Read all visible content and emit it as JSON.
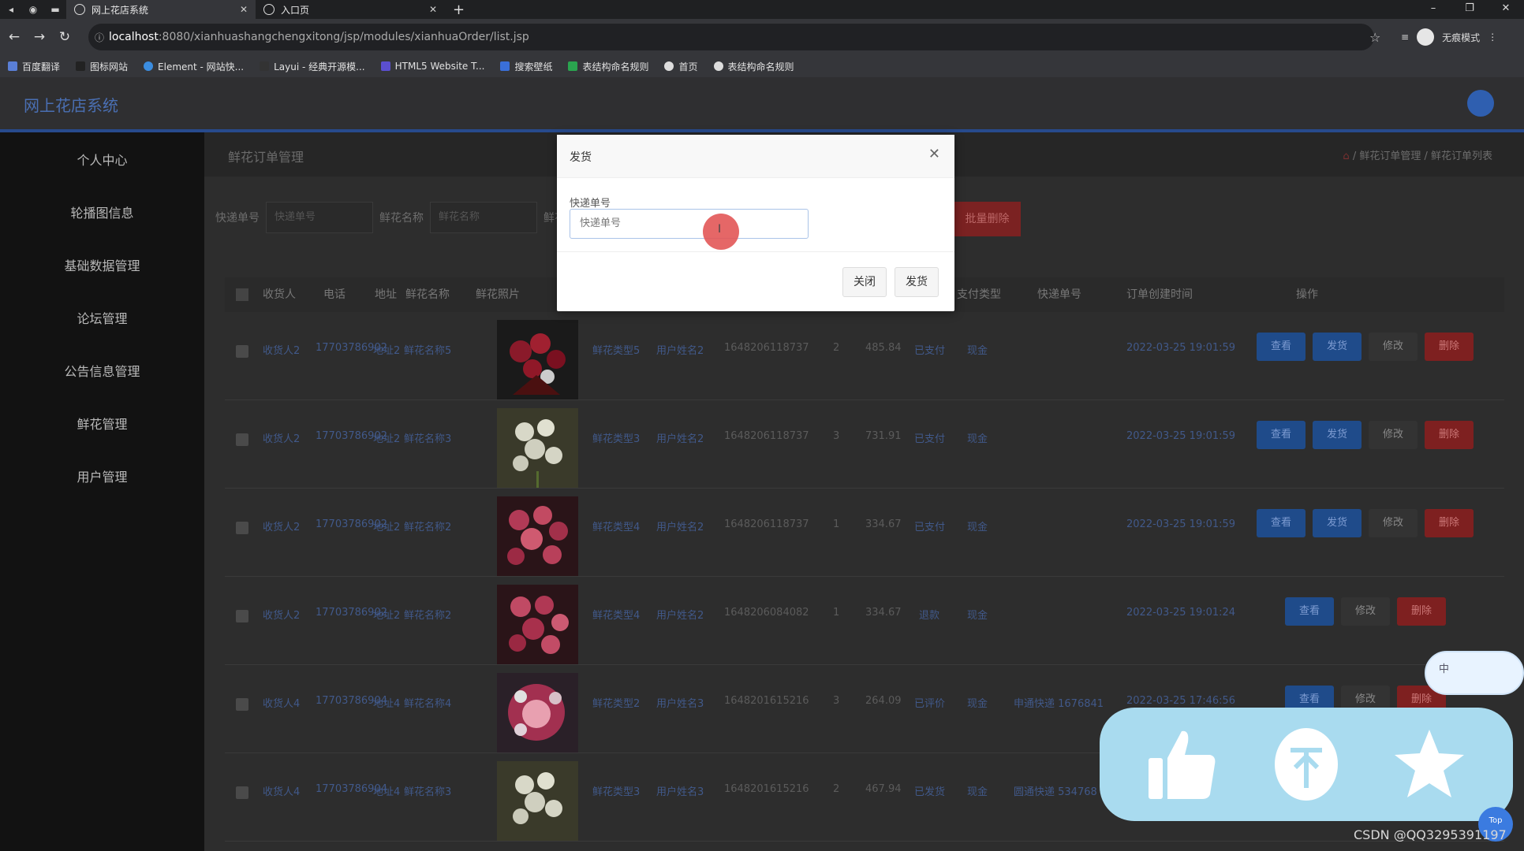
{
  "browser": {
    "tabs": [
      {
        "title": "网上花店系统",
        "active": true
      },
      {
        "title": "入口页",
        "active": false
      }
    ],
    "url_host": "localhost",
    "url_path": ":8080/xianhuashangchengxitong/jsp/modules/xianhuaOrder/list.jsp",
    "incognito_label": "无痕模式",
    "bookmarks": [
      "百度翻译",
      "图标网站",
      "Element - 网站快...",
      "Layui - 经典开源模...",
      "HTML5 Website T...",
      "搜索壁纸",
      "表结构命名规则",
      "首页",
      "表结构命名规则"
    ]
  },
  "app": {
    "title": "网上花店系统",
    "sidebar": [
      "个人中心",
      "轮播图信息",
      "基础数据管理",
      "论坛管理",
      "公告信息管理",
      "鲜花管理",
      "用户管理"
    ]
  },
  "main": {
    "crumb_title": "鲜花订单管理",
    "breadcrumb": "鲜花订单管理 / 鲜花订单列表",
    "search": {
      "label1": "快递单号",
      "placeholder1": "快递单号",
      "label2": "鲜花名称",
      "placeholder2": "鲜花名称",
      "label3": "鲜花"
    },
    "batch_delete": "批量删除",
    "headers": [
      "收货人",
      "电话",
      "地址",
      "鲜花名称",
      "鲜花照片",
      "支付类型",
      "快递单号",
      "订单创建时间",
      "操作"
    ],
    "rows": [
      {
        "receiver": "收货人2",
        "phone": "17703786902",
        "addr": "地址2",
        "flower": "鲜花名称5",
        "type": "鲜花类型5",
        "user": "用户姓名2",
        "order_no": "1648206118737",
        "qty": "2",
        "price": "485.84",
        "status": "已支付",
        "pay": "现金",
        "express": "",
        "time": "2022-03-25 19:01:59",
        "actions": [
          "查看",
          "发货",
          "修改",
          "删除"
        ],
        "photo": "red"
      },
      {
        "receiver": "收货人2",
        "phone": "17703786902",
        "addr": "地址2",
        "flower": "鲜花名称3",
        "type": "鲜花类型3",
        "user": "用户姓名2",
        "order_no": "1648206118737",
        "qty": "3",
        "price": "731.91",
        "status": "已支付",
        "pay": "现金",
        "express": "",
        "time": "2022-03-25 19:01:59",
        "actions": [
          "查看",
          "发货",
          "修改",
          "删除"
        ],
        "photo": "white"
      },
      {
        "receiver": "收货人2",
        "phone": "17703786902",
        "addr": "地址2",
        "flower": "鲜花名称2",
        "type": "鲜花类型4",
        "user": "用户姓名2",
        "order_no": "1648206118737",
        "qty": "1",
        "price": "334.67",
        "status": "已支付",
        "pay": "现金",
        "express": "",
        "time": "2022-03-25 19:01:59",
        "actions": [
          "查看",
          "发货",
          "修改",
          "删除"
        ],
        "photo": "pink"
      },
      {
        "receiver": "收货人2",
        "phone": "17703786902",
        "addr": "地址2",
        "flower": "鲜花名称2",
        "type": "鲜花类型4",
        "user": "用户姓名2",
        "order_no": "1648206084082",
        "qty": "1",
        "price": "334.67",
        "status": "退款",
        "pay": "现金",
        "express": "",
        "time": "2022-03-25 19:01:24",
        "actions": [
          "查看",
          "修改",
          "删除"
        ],
        "photo": "pink"
      },
      {
        "receiver": "收货人4",
        "phone": "17703786904",
        "addr": "地址4",
        "flower": "鲜花名称4",
        "type": "鲜花类型2",
        "user": "用户姓名3",
        "order_no": "1648201615216",
        "qty": "3",
        "price": "264.09",
        "status": "已评价",
        "pay": "现金",
        "express": "申通快递 1676841",
        "time": "2022-03-25 17:46:56",
        "actions": [
          "查看",
          "修改",
          "删除"
        ],
        "photo": "mixed"
      },
      {
        "receiver": "收货人4",
        "phone": "17703786904",
        "addr": "地址4",
        "flower": "鲜花名称3",
        "type": "鲜花类型3",
        "user": "用户姓名3",
        "order_no": "1648201615216",
        "qty": "2",
        "price": "467.94",
        "status": "已发货",
        "pay": "现金",
        "express": "圆通快递 534768",
        "time": "",
        "actions": [],
        "photo": "white"
      }
    ]
  },
  "dialog": {
    "title": "发货",
    "field_label": "快递单号",
    "field_placeholder": "快递单号",
    "close_label": "关闭",
    "confirm_label": "发货"
  },
  "overlay": {
    "ime_text": "中",
    "top_label": "Top",
    "watermark": "CSDN @QQ3295391197"
  },
  "colors": {
    "accent": "#2f5fb0",
    "danger": "#c0392b",
    "float_panel": "#a9dbef"
  }
}
